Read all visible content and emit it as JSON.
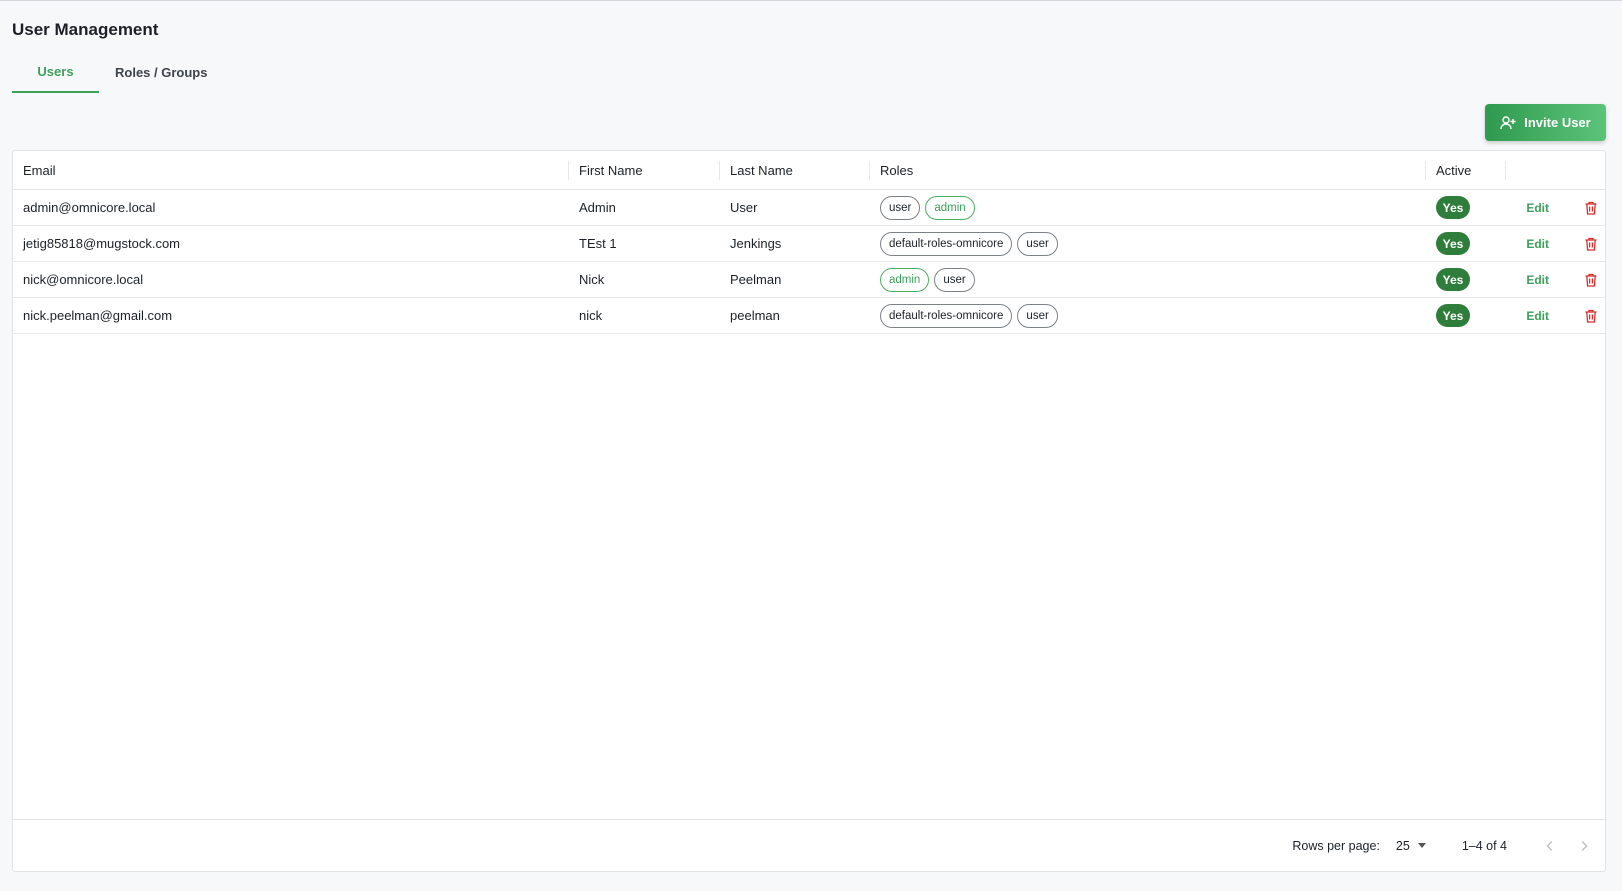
{
  "page": {
    "title": "User Management"
  },
  "tabs": [
    {
      "label": "Users",
      "active": true
    },
    {
      "label": "Roles / Groups",
      "active": false
    }
  ],
  "toolbar": {
    "invite_label": "Invite User",
    "invite_icon": "person-add-icon"
  },
  "table": {
    "columns": [
      "Email",
      "First Name",
      "Last Name",
      "Roles",
      "Active"
    ],
    "rows": [
      {
        "email": "admin@omnicore.local",
        "first": "Admin",
        "last": "User",
        "roles": [
          "user",
          "admin"
        ],
        "active": "Yes",
        "edit": "Edit"
      },
      {
        "email": "jetig85818@mugstock.com",
        "first": "TEst 1",
        "last": "Jenkings",
        "roles": [
          "default-roles-omnicore",
          "user"
        ],
        "active": "Yes",
        "edit": "Edit"
      },
      {
        "email": "nick@omnicore.local",
        "first": "Nick",
        "last": "Peelman",
        "roles": [
          "admin",
          "user"
        ],
        "active": "Yes",
        "edit": "Edit"
      },
      {
        "email": "nick.peelman@gmail.com",
        "first": "nick",
        "last": "peelman",
        "roles": [
          "default-roles-omnicore",
          "user"
        ],
        "active": "Yes",
        "edit": "Edit"
      }
    ]
  },
  "pagination": {
    "rows_per_page_label": "Rows per page:",
    "rows_per_page": "25",
    "range": "1–4 of 4"
  },
  "colors": {
    "accent": "#3fa05b",
    "active_badge": "#2e7d3a",
    "delete": "#d32f2f"
  }
}
